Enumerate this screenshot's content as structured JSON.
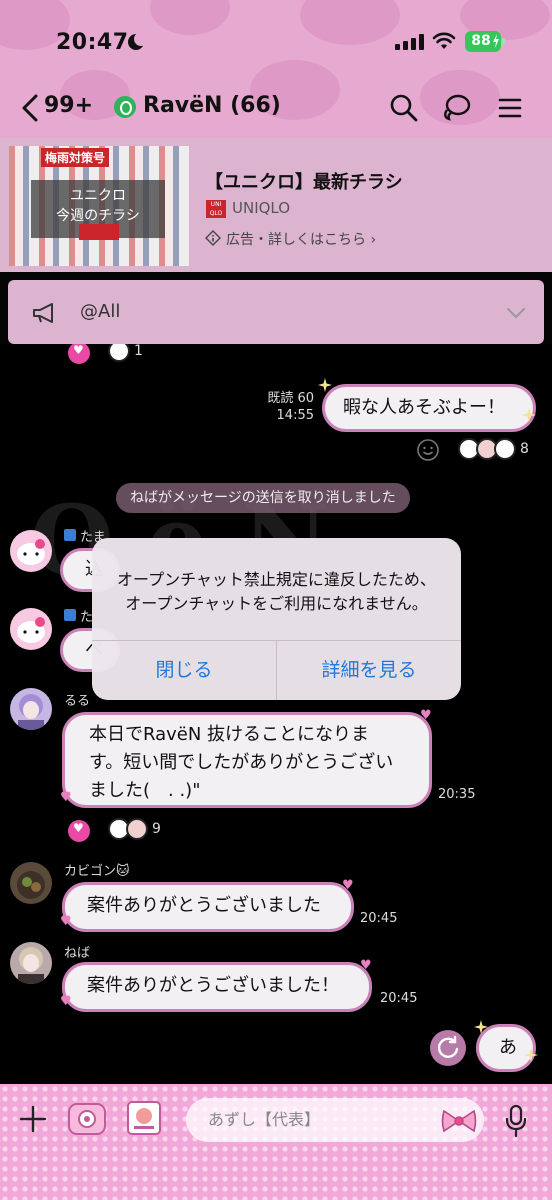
{
  "status_bar": {
    "time": "20:47",
    "battery": "88"
  },
  "nav": {
    "back_count": "99+",
    "room_title": "RavëN (66)"
  },
  "ad": {
    "thumb_tag": "梅雨対策号",
    "thumb_line1": "ユニクロ",
    "thumb_line2": "今週のチラシ",
    "title": "【ユニクロ】最新チラシ",
    "brand": "UNIQLO",
    "link": "広告・詳しくはこちら ›"
  },
  "announcement": {
    "text": "@All"
  },
  "messages": {
    "react1_count": "1",
    "own_msg": {
      "read": "既読 60",
      "time": "14:55",
      "text": "暇な人あそぶよー！",
      "react_count": "8"
    },
    "system": "ねばがメッセージの送信を取り消しました",
    "hidden1_sender": "たま",
    "hidden1_text": "込",
    "hidden2_sender": "た",
    "hidden2_text": "ペ",
    "ruru": {
      "sender": "るる",
      "line1": "本日でRavëN 抜けることになりま",
      "line2": "す。短い間でしたがありがとうござい",
      "line3": "ました(　. .)\"",
      "time": "20:35",
      "react_count": "9"
    },
    "kabigon": {
      "sender": "カビゴン🐱",
      "text": "案件ありがとうございました",
      "time": "20:45"
    },
    "neba": {
      "sender": "ねば",
      "text": "案件ありがとうございました！",
      "time": "20:45"
    },
    "pending_text": "あ"
  },
  "alert": {
    "line1": "オープンチャット禁止規定に違反したため、",
    "line2": "オープンチャットをご利用になれません。",
    "close": "閉じる",
    "details": "詳細を見る"
  },
  "input": {
    "placeholder": "あずし【代表】"
  },
  "colors": {
    "header_pink": "#e6a9d0",
    "bubble_border": "#c981b7",
    "alert_button": "#2378d8",
    "online_green": "#2eb25a"
  }
}
